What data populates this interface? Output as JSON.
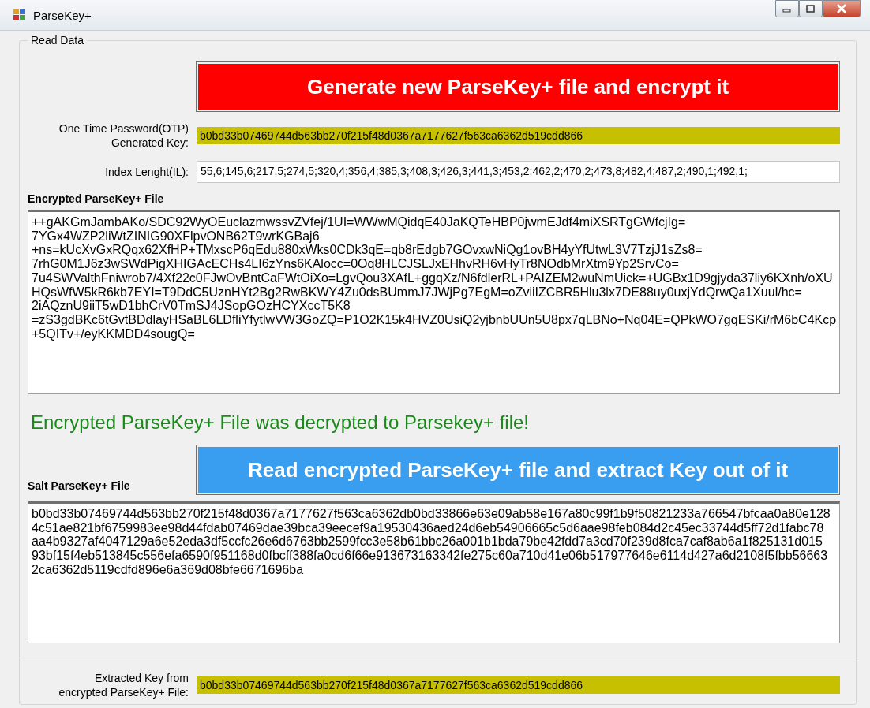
{
  "window": {
    "title": "ParseKey+"
  },
  "group": {
    "title": "Read Data"
  },
  "generate_button": {
    "label": "Generate new ParseKey+ file and encrypt it"
  },
  "otp": {
    "label_lines": [
      "One Time Password(OTP)",
      "Generated Key:"
    ],
    "value": "b0bd33b07469744d563bb270f215f48d0367a7177627f563ca6362d519cdd866"
  },
  "index_length": {
    "label": "Index Lenght(IL):",
    "value": "55,6;145,6;217,5;274,5;320,4;356,4;385,3;408,3;426,3;441,3;453,2;462,2;470,2;473,8;482,4;487,2;490,1;492,1;"
  },
  "encrypted_file": {
    "label": "Encrypted ParseKey+ File",
    "lines": [
      "++gAKGmJambAKo/SDC92WyOEuclazmwssvZVfej/1UI=WWwMQidqE40JaKQTeHBP0jwmEJdf4miXSRTgGWfcjIg=",
      "7YGx4WZP2liWtZINIG90XFlpvONB62T9wrKGBaj6",
      "+ns=kUcXvGxRQqx62XfHP+TMxscP6qEdu880xWks0CDk3qE=qb8rEdgb7GOvxwNiQg1ovBH4yYfUtwL3V7TzjJ1sZs8=",
      "7rhG0M1J6z3wSWdPigXHIGAcECHs4LI6zYns6KAlocc=0Oq8HLCJSLJxEHhvRH6vHyTr8NOdbMrXtm9Yp2SrvCo=",
      "7u4SWValthFniwrob7/4Xf22c0FJwOvBntCaFWtOiXo=LgvQou3XAfL+ggqXz/N6fdlerRL+PAIZEM2wuNmUick=+UGBx1D9gjyda37liy6KXnh/oXU",
      "HQsWfW5kR6kb7EYI=T9DdC5UznHYt2Bg2RwBKWY4Zu0dsBUmmJ7JWjPg7EgM=oZviiIZCBR5Hlu3lx7DE88uy0uxjYdQrwQa1Xuul/hc=",
      "2iAQznU9iiT5wD1bhCrV0TmSJ4JSopGOzHCYXccT5K8",
      "=zS3gdBKc6tGvtBDdlayHSaBL6LDfliYfytlwVW3GoZQ=P1O2K15k4HVZ0UsiQ2yjbnbUUn5U8px7qLBNo+Nq04E=QPkWO7gqESKi/rM6bC4Kcp",
      "+5QITv+/eyKKMDD4sougQ="
    ]
  },
  "status_message": {
    "text": "Encrypted ParseKey+ File was decrypted to Parsekey+ file!"
  },
  "read_button": {
    "label": "Read encrypted ParseKey+ file and extract Key out of it"
  },
  "salt_file": {
    "label": "Salt ParseKey+ File",
    "lines": [
      "b0bd33b07469744d563bb270f215f48d0367a7177627f563ca6362db0bd33866e63e09ab58e167a80c99f1b9f50821233a766547bfcaa0a80e128",
      "4c51ae821bf6759983ee98d44fdab07469dae39bca39eecef9a19530436aed24d6eb54906665c5d6aae98feb084d2c45ec33744d5ff72d1fabc78",
      "aa4b9327af4047129a6e52eda3df5ccfc26e6d6763bb2599fcc3e58b61bbc26a001b1bda79be42fdd7a3cd70f239d8fca7caf8ab6a1f825131d015",
      "93bf15f4eb513845c556efa6590f951168d0fbcff388fa0cd6f66e913673163342fe275c60a710d41e06b517977646e6114d427a6d2108f5fbb56663",
      "2ca6362d5119cdfd896e6a369d08bfe6671696ba"
    ]
  },
  "extracted": {
    "label_lines": [
      "Extracted Key from",
      "encrypted ParseKey+ File:"
    ],
    "value": "b0bd33b07469744d563bb270f215f48d0367a7177627f563ca6362d519cdd866"
  }
}
